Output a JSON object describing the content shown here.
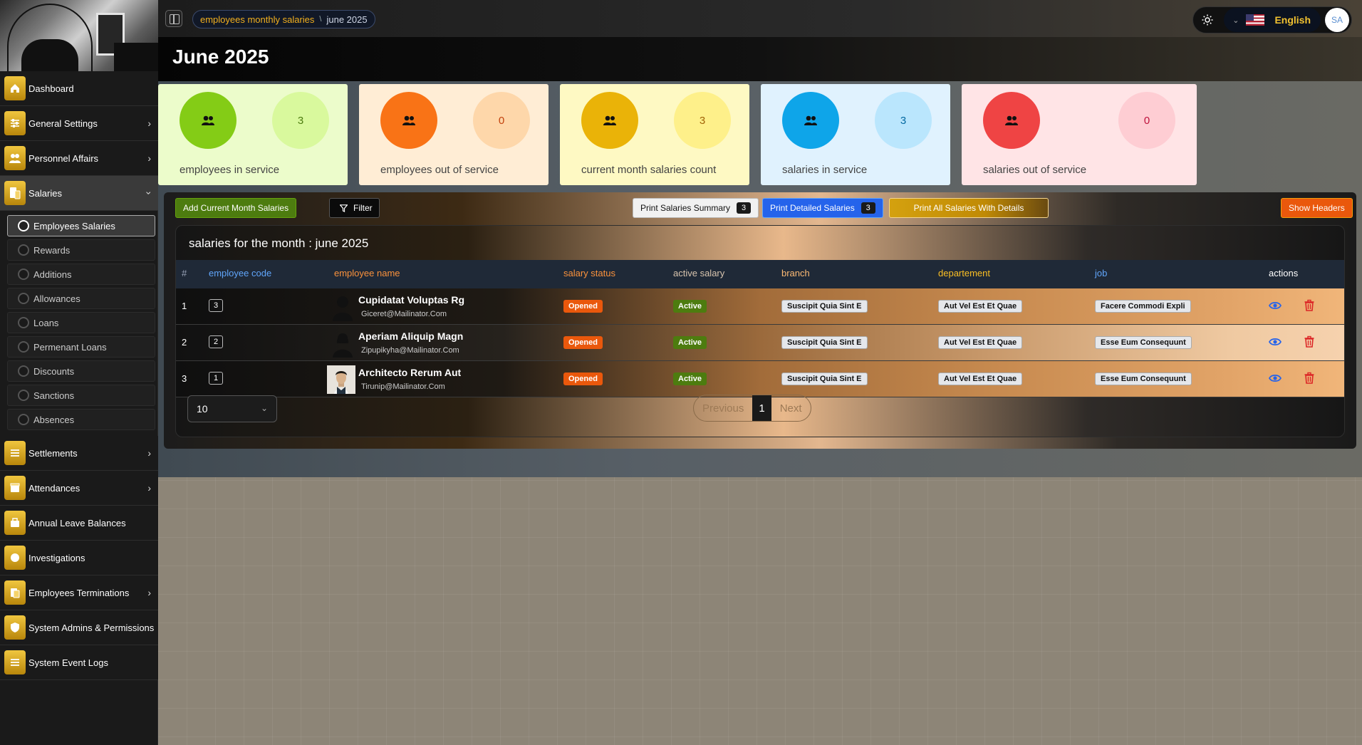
{
  "sidebar": {
    "items_top": [
      {
        "label": "Dashboard",
        "icon": "home-icon",
        "has_chevron": false
      },
      {
        "label": "General Settings",
        "icon": "sliders-icon",
        "has_chevron": true
      },
      {
        "label": "Personnel Affairs",
        "icon": "people-icon",
        "has_chevron": true
      }
    ],
    "active_item": {
      "label": "Salaries",
      "icon": "salary-icon"
    },
    "submenu": [
      {
        "label": "Employees Salaries",
        "active": true
      },
      {
        "label": "Rewards"
      },
      {
        "label": "Additions"
      },
      {
        "label": "Allowances"
      },
      {
        "label": "Loans"
      },
      {
        "label": "Permenant Loans"
      },
      {
        "label": "Discounts"
      },
      {
        "label": "Sanctions"
      },
      {
        "label": "Absences"
      }
    ],
    "items_bottom": [
      {
        "label": "Settlements",
        "icon": "list-icon",
        "has_chevron": true
      },
      {
        "label": "Attendances",
        "icon": "calendar-icon",
        "has_chevron": true
      },
      {
        "label": "Annual Leave Balances",
        "icon": "briefcase-icon",
        "has_chevron": false
      },
      {
        "label": "Investigations",
        "icon": "circle-icon",
        "has_chevron": false
      },
      {
        "label": "Employees Terminations",
        "icon": "document-icon",
        "has_chevron": true
      },
      {
        "label": "System Admins & Permissions",
        "icon": "shield-icon",
        "has_chevron": false
      },
      {
        "label": "System Event Logs",
        "icon": "log-icon",
        "has_chevron": false
      }
    ]
  },
  "topbar": {
    "breadcrumb": {
      "parent": "employees monthly salaries",
      "separator": "\\",
      "current": "june 2025"
    },
    "language": "English",
    "avatar_initials": "SA"
  },
  "page": {
    "title": "June 2025"
  },
  "stats": [
    {
      "label": "employees in service",
      "count": "3",
      "card_bg": "#ecfccb",
      "circle_bg": "#84cc16",
      "count_bg": "#d9f99d",
      "count_color": "#4d7c0f"
    },
    {
      "label": "employees out of service",
      "count": "0",
      "card_bg": "#ffedd5",
      "circle_bg": "#f97316",
      "count_bg": "#fed7aa",
      "count_color": "#c2410c"
    },
    {
      "label": "current month salaries count",
      "count": "3",
      "card_bg": "#fef9c3",
      "circle_bg": "#eab308",
      "count_bg": "#fef08a",
      "count_color": "#a16207"
    },
    {
      "label": "salaries in service",
      "count": "3",
      "card_bg": "#e0f2fe",
      "circle_bg": "#0ea5e9",
      "count_bg": "#bae6fd",
      "count_color": "#0369a1"
    },
    {
      "label": "salaries out of service",
      "count": "0",
      "card_bg": "#ffe4e6",
      "circle_bg": "#ef4444",
      "count_bg": "#fecdd3",
      "count_color": "#be123c"
    }
  ],
  "toolbar": {
    "add_label": "Add Current Month Salaries",
    "filter_label": "Filter",
    "print_summary_label": "Print Salaries Summary",
    "print_summary_count": "3",
    "print_detailed_label": "Print Detailed Salaries",
    "print_detailed_count": "3",
    "print_all_label": "Print All Salaries With Details",
    "show_headers_label": "Show Headers"
  },
  "table": {
    "title": "salaries for the month : june 2025",
    "columns": {
      "index": "#",
      "code": "employee code",
      "name": "employee name",
      "status": "salary status",
      "active": "active salary",
      "branch": "branch",
      "department": "departement",
      "job": "job",
      "actions": "actions"
    },
    "rows": [
      {
        "index": "1",
        "code": "3",
        "name": "Cupidatat Voluptas Rg",
        "email": "Giceret@Mailinator.Com",
        "status": "Opened",
        "active": "Active",
        "branch": "Suscipit Quia Sint E",
        "department": "Aut Vel Est Et Quae",
        "job": "Facere Commodi Expli",
        "photo": "male-silhouette"
      },
      {
        "index": "2",
        "code": "2",
        "name": "Aperiam Aliquip Magn",
        "email": "Zipupikyha@Mailinator.Com",
        "status": "Opened",
        "active": "Active",
        "branch": "Suscipit Quia Sint E",
        "department": "Aut Vel Est Et Quae",
        "job": "Esse Eum Consequunt",
        "photo": "female-silhouette"
      },
      {
        "index": "3",
        "code": "1",
        "name": "Architecto Rerum Aut",
        "email": "Tirunip@Mailinator.Com",
        "status": "Opened",
        "active": "Active",
        "branch": "Suscipit Quia Sint E",
        "department": "Aut Vel Est Et Quae",
        "job": "Esse Eum Consequunt",
        "photo": "portrait-photo"
      }
    ],
    "page_size": "10",
    "pagination": {
      "prev": "Previous",
      "current": "1",
      "next": "Next"
    }
  }
}
